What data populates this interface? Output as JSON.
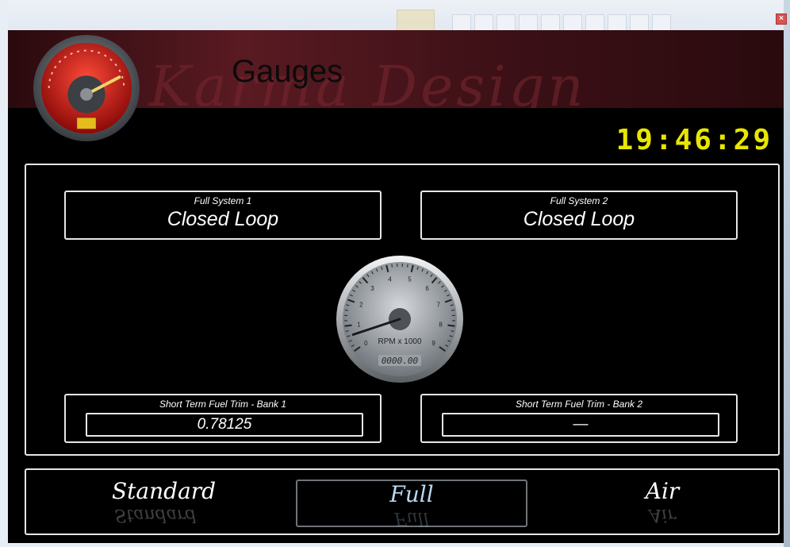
{
  "app": {
    "title": "Gauges",
    "watermark": "Karma Design",
    "clock": "19:46:29",
    "close_glyph": "×"
  },
  "fuel_system": {
    "bank1": {
      "label": "Full System 1",
      "value": "Closed Loop"
    },
    "bank2": {
      "label": "Full System 2",
      "value": "Closed Loop"
    }
  },
  "fuel_trim": {
    "bank1": {
      "label": "Short Term Fuel Trim - Bank 1",
      "value": "0.78125"
    },
    "bank2": {
      "label": "Short Term Fuel Trim - Bank 2",
      "value": "—"
    }
  },
  "rpm_gauge": {
    "unit_label": "RPM x 1000",
    "readout": "0000.00",
    "ticks": [
      "0",
      "1",
      "2",
      "3",
      "4",
      "5",
      "6",
      "7",
      "8",
      "9"
    ],
    "needle_value": 0.6
  },
  "modes": {
    "standard": "Standard",
    "full": "Full",
    "air": "Air",
    "selected": "full"
  },
  "colors": {
    "clock": "#e8e600",
    "selected_mode": "#b9d8f3",
    "background": "#000000",
    "border": "#e6e6e6"
  }
}
